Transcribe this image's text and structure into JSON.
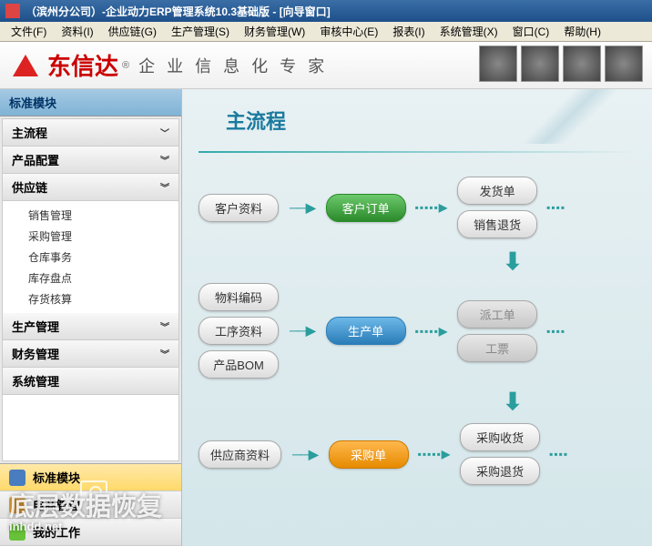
{
  "titlebar": {
    "text": "（滨州分公司）-企业动力ERP管理系统10.3基础版 - [向导窗口]"
  },
  "menubar": [
    "文件(F)",
    "资料(I)",
    "供应链(G)",
    "生产管理(S)",
    "财务管理(W)",
    "审核中心(E)",
    "报表(I)",
    "系统管理(X)",
    "窗口(C)",
    "帮助(H)"
  ],
  "logo": {
    "name": "东信达",
    "sub": "企 业 信 息 化 专 家"
  },
  "sidebar": {
    "title": "标准模块",
    "sections": [
      {
        "label": "主流程",
        "expand": "single"
      },
      {
        "label": "产品配置",
        "expand": "double"
      },
      {
        "label": "供应链",
        "expand": "double",
        "children": [
          "销售管理",
          "采购管理",
          "仓库事务",
          "库存盘点",
          "存货核算"
        ]
      },
      {
        "label": "生产管理",
        "expand": "double"
      },
      {
        "label": "财务管理",
        "expand": "double"
      },
      {
        "label": "系统管理",
        "expand": "none"
      }
    ],
    "bottom": [
      {
        "label": "标准模块",
        "active": true,
        "icon_bg": "#4a7dbf"
      },
      {
        "label": "电商管理",
        "active": false,
        "icon_bg": "#e6a23c"
      },
      {
        "label": "我的工作",
        "active": false,
        "icon_bg": "#67c23a"
      }
    ]
  },
  "main": {
    "title": "主流程",
    "rows": [
      {
        "left": [
          {
            "label": "客户资料",
            "cls": ""
          }
        ],
        "mid": {
          "label": "客户订单",
          "cls": "green"
        },
        "right": [
          {
            "label": "发货单",
            "cls": ""
          },
          {
            "label": "销售退货",
            "cls": ""
          }
        ]
      },
      {
        "left": [
          {
            "label": "物料编码",
            "cls": ""
          },
          {
            "label": "工序资料",
            "cls": ""
          },
          {
            "label": "产品BOM",
            "cls": ""
          }
        ],
        "mid": {
          "label": "生产单",
          "cls": "blue"
        },
        "right": [
          {
            "label": "派工单",
            "cls": "gray"
          },
          {
            "label": "工票",
            "cls": "gray"
          }
        ]
      },
      {
        "left": [
          {
            "label": "供应商资料",
            "cls": ""
          }
        ],
        "mid": {
          "label": "采购单",
          "cls": "orange"
        },
        "right": [
          {
            "label": "采购收货",
            "cls": ""
          },
          {
            "label": "采购退货",
            "cls": ""
          }
        ]
      }
    ]
  },
  "watermark": {
    "big": "底层数据恢复",
    "small": "inhdd.net"
  }
}
